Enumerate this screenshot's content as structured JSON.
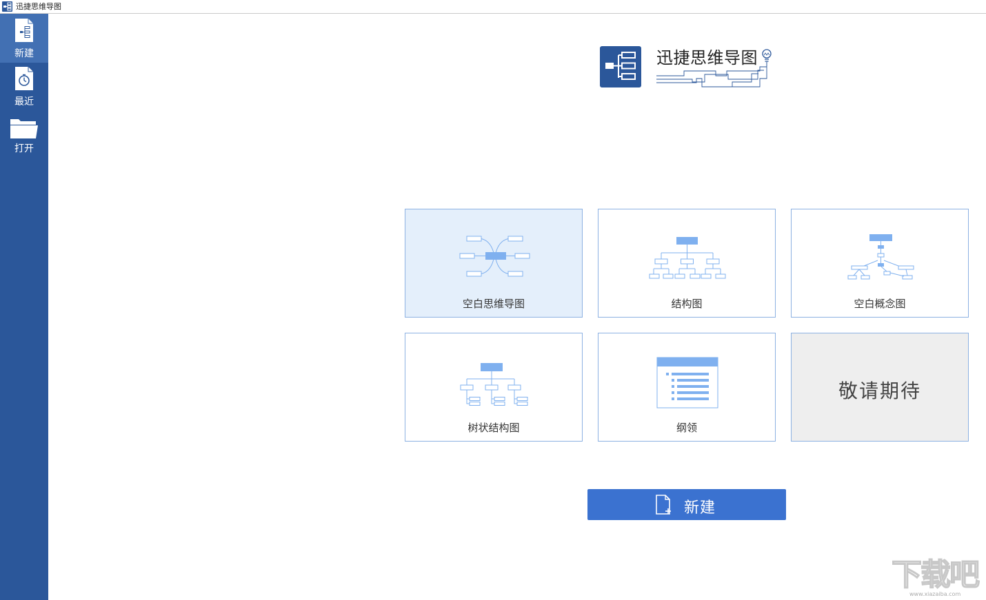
{
  "window": {
    "title": "迅捷思维导图"
  },
  "sidebar": {
    "items": [
      {
        "label": "新建",
        "icon": "new-file-icon",
        "active": true
      },
      {
        "label": "最近",
        "icon": "recent-clock-icon",
        "active": false
      },
      {
        "label": "打开",
        "icon": "open-folder-icon",
        "active": false
      }
    ]
  },
  "logo": {
    "title": "迅捷思维导图",
    "icon": "mindmap-logo-icon",
    "bulb_icon": "lightbulb-icon"
  },
  "templates": [
    {
      "label": "空白思维导图",
      "icon": "mindmap-template-icon",
      "selected": true
    },
    {
      "label": "结构图",
      "icon": "structure-chart-icon",
      "selected": false
    },
    {
      "label": "空白概念图",
      "icon": "concept-map-icon",
      "selected": false
    },
    {
      "label": "树状结构图",
      "icon": "tree-chart-icon",
      "selected": false
    },
    {
      "label": "纲领",
      "icon": "outline-icon",
      "selected": false
    },
    {
      "label": "敬请期待",
      "disabled": true
    }
  ],
  "actions": {
    "new_label": "新建",
    "new_icon": "new-document-icon"
  },
  "watermark": {
    "text": "下载吧",
    "url": "www.xiazaiba.com"
  },
  "colors": {
    "sidebar": "#2b579a",
    "sidebar_active": "#4270b3",
    "card_border": "#8cb1e2",
    "card_selected": "#e4effb",
    "diagram_blue": "#7fb0ef",
    "button": "#3b72d0"
  }
}
